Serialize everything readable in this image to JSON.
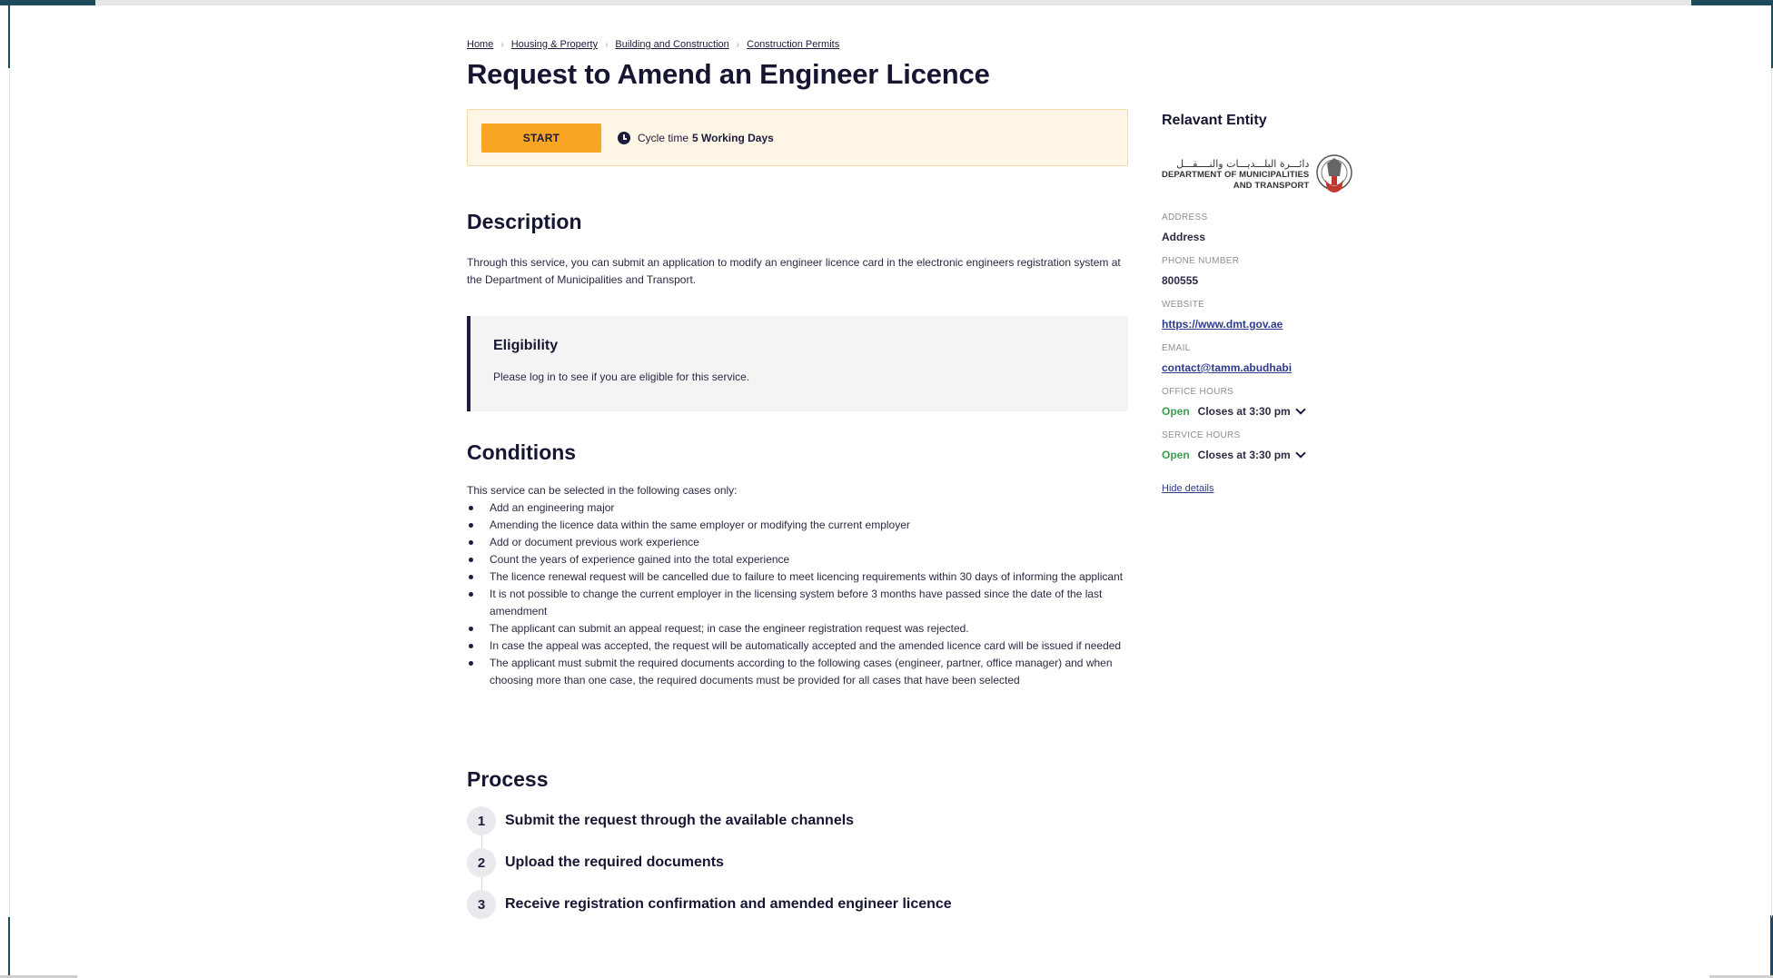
{
  "breadcrumb": [
    "Home",
    "Housing & Property",
    "Building and Construction",
    "Construction Permits"
  ],
  "page": {
    "title": "Request to Amend an Engineer Licence"
  },
  "start": {
    "button_label": "START",
    "cycle_label": "Cycle time",
    "cycle_value": "5 Working Days"
  },
  "description": {
    "title": "Description",
    "text": "Through this service, you can submit an application to modify an engineer licence card in the electronic engineers registration system at the Department of Municipalities and Transport."
  },
  "eligibility": {
    "title": "Eligibility",
    "text": "Please log in to see if you are eligible for this service."
  },
  "conditions": {
    "title": "Conditions",
    "intro": "This service can be selected in the following cases only:",
    "items": [
      "Add an engineering major",
      "Amending the licence data within the same employer or modifying the current employer",
      "Add or document previous work experience",
      "Count the years of experience gained into the total experience",
      "The licence renewal request will be cancelled due to failure to meet licencing requirements within 30 days of informing the applicant",
      "It is not possible to change the current employer in the licensing  system before 3 months have passed since the date of the last amendment",
      "The applicant can submit an appeal request; in case the engineer registration request was rejected.",
      "In case the appeal was accepted, the request will be automatically accepted and the amended licence card will be issued if needed",
      "The applicant must submit the required documents according to the following cases (engineer, partner, office manager) and when choosing more than one case, the required documents must be provided for all cases that have been selected"
    ]
  },
  "process": {
    "title": "Process",
    "steps": [
      {
        "num": "1",
        "label": "Submit the request through the available channels"
      },
      {
        "num": "2",
        "label": "Upload the required documents"
      },
      {
        "num": "3",
        "label": "Receive registration confirmation and amended engineer licence"
      }
    ]
  },
  "entity": {
    "title": "Relavant Entity",
    "logo_ar": "دائـــرة البلـــديـــات والنــــقـــل",
    "logo_en_1": "DEPARTMENT OF MUNICIPALITIES",
    "logo_en_2": "AND TRANSPORT",
    "address_label": "ADDRESS",
    "address": "Address",
    "phone_label": "PHONE NUMBER",
    "phone": "800555",
    "website_label": "WEBSITE",
    "website": "https://www.dmt.gov.ae",
    "email_label": "EMAIL",
    "email": "contact@tamm.abudhabi",
    "office_hours_label": "OFFICE HOURS",
    "office_status": "Open",
    "office_close": "Closes at 3:30 pm",
    "service_hours_label": "SERVICE HOURS",
    "service_status": "Open",
    "service_close": "Closes at 3:30 pm",
    "hide_details": "Hide details"
  },
  "colors": {
    "accent": "#f8a523",
    "text": "#1c1c3c",
    "open": "#3a9e4a",
    "link": "#2e3a8c"
  }
}
